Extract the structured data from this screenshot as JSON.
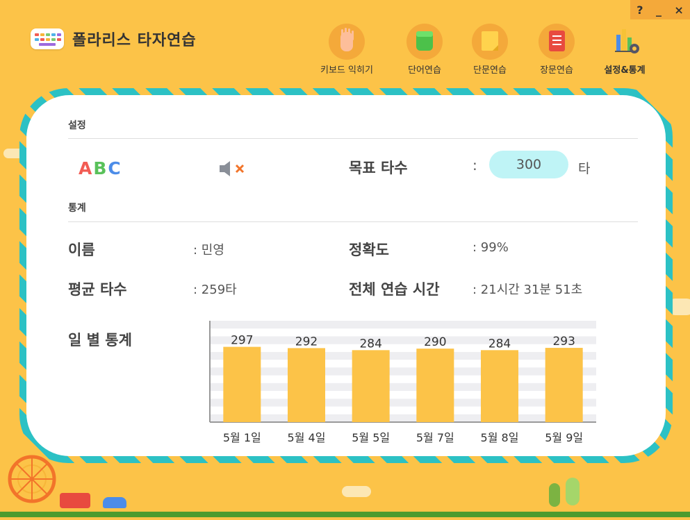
{
  "window": {
    "help": "?",
    "minimize": "_",
    "close": "×"
  },
  "app": {
    "title": "폴라리스 타자연습"
  },
  "nav": [
    {
      "label": "키보드 익히기",
      "icon": "hand-icon"
    },
    {
      "label": "단어연습",
      "icon": "green-block-icon"
    },
    {
      "label": "단문연습",
      "icon": "sticky-note-icon"
    },
    {
      "label": "장문연습",
      "icon": "notebook-icon"
    },
    {
      "label": "설정&통계",
      "icon": "chart-gear-icon",
      "active": true
    }
  ],
  "settings": {
    "title": "설정",
    "font_sample": "ABC",
    "sound_icon": "mute-icon",
    "target_label": "목표 타수",
    "colon": ":",
    "target_value": "300",
    "target_unit": "타"
  },
  "stats": {
    "title": "통계",
    "name_label": "이름",
    "name_value": ": 민영",
    "accuracy_label": "정확도",
    "accuracy_value": ": 99%",
    "avg_label": "평균 타수",
    "avg_value": ": 259타",
    "total_label": "전체 연습 시간",
    "total_value": ": 21시간 31분 51초",
    "daily_label": "일 별 통계"
  },
  "chart_data": {
    "type": "bar",
    "categories": [
      "5월 1일",
      "5월 4일",
      "5월 5일",
      "5월 7일",
      "5월 8일",
      "5월 9일"
    ],
    "values": [
      297,
      292,
      284,
      290,
      284,
      293
    ],
    "ylim": [
      0,
      400
    ],
    "bar_color": "#FCC348",
    "grid": true
  },
  "colors": {
    "background": "#FCC348",
    "accent": "#2CC1C4",
    "pill": "#BFF4F6"
  }
}
